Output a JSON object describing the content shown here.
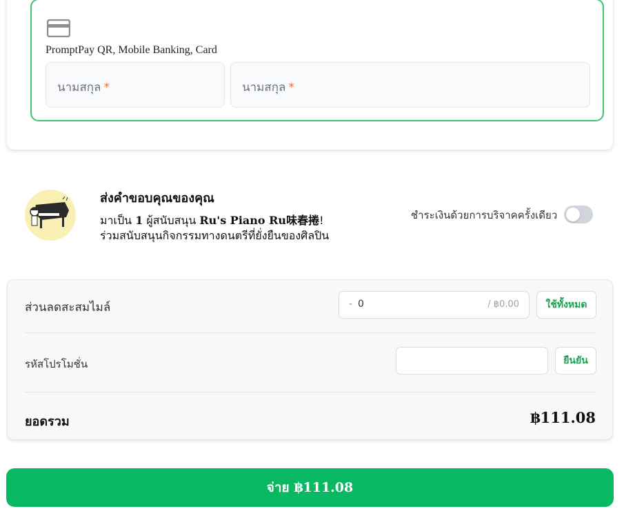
{
  "payment": {
    "methods_text": "PromptPay QR, Mobile Banking, Card",
    "first_name_placeholder": "นามสกุล",
    "last_name_placeholder": "นามสกุล",
    "required_mark": "*"
  },
  "thanks": {
    "title": "ส่งคำขอบคุณของคุณ",
    "line1_prefix": "มาเป็น ",
    "supporter_count": "1",
    "line1_mid": " ผู้สนับสนุน ",
    "creator_name": "Ru's Piano Ru味春捲",
    "line1_suffix": "!",
    "line2": "ร่วมสนับสนุนกิจกรรมทางดนตรีที่ยั่งยืนของศิลปิน",
    "onetime_label": "ชำระเงินด้วยการบริจาคครั้งเดียว",
    "onetime_enabled": false
  },
  "summary": {
    "miles_label": "ส่วนลดสะสมไมล์",
    "miles_minus": "-",
    "miles_value": "0",
    "miles_suffix": "/ ฿0.00",
    "use_all_label": "ใช้ทั้งหมด",
    "promo_label": "รหัสโปรโมชั่น",
    "promo_value": "",
    "confirm_label": "ยืนยัน",
    "total_label": "ยอดรวม",
    "total_value": "฿111.08"
  },
  "pay_button": {
    "label": "จ่าย ฿111.08"
  },
  "colors": {
    "accent": "#08b862",
    "selected_border": "#3cc36a",
    "required": "#e8733a",
    "link_green": "#1aa053"
  }
}
